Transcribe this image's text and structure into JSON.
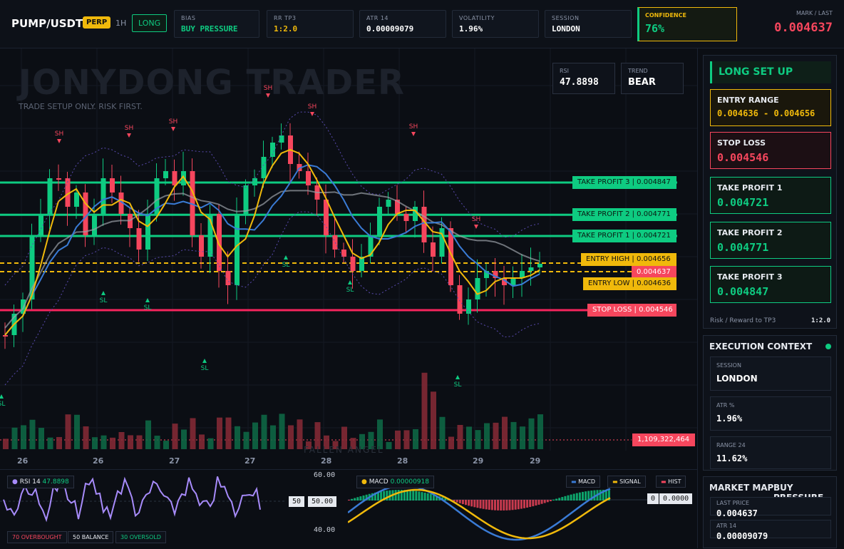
{
  "header": {
    "symbol": "PUMP/USDT",
    "contract": "PERP",
    "timeframe": "1H",
    "side": "LONG",
    "stats": [
      {
        "label": "BIAS",
        "value": "BUY PRESSURE",
        "color": "#0ecb81"
      },
      {
        "label": "RR TP3",
        "value": "1:2.0",
        "color": "#f0b90b"
      },
      {
        "label": "ATR 14",
        "value": "0.00009079",
        "color": "#ffffff"
      },
      {
        "label": "VOLATILITY",
        "value": "1.96%",
        "color": "#ffffff"
      },
      {
        "label": "SESSION",
        "value": "LONDON",
        "color": "#ffffff"
      }
    ],
    "confidence": {
      "label": "CONFIDENCE",
      "value": "76%"
    },
    "mark": {
      "label": "MARK / LAST",
      "value": "0.004637"
    }
  },
  "chart": {
    "watermark": "JONYDONG TRADER",
    "watermark_sub": "TRADE SETUP ONLY. RISK FIRST.",
    "watermark_bottom": "FALLEN ANGEL",
    "rsi_box": {
      "label": "RSI",
      "value": "47.8898"
    },
    "trend_box": {
      "label": "TREND",
      "value": "BEAR"
    },
    "levels": {
      "tp3": {
        "label": "TAKE PROFIT 3",
        "value": "0.004847"
      },
      "tp2": {
        "label": "TAKE PROFIT 2",
        "value": "0.004771"
      },
      "tp1": {
        "label": "TAKE PROFIT 1",
        "value": "0.004721"
      },
      "entry_high": {
        "label": "ENTRY HIGH",
        "value": "0.004656"
      },
      "last": {
        "value": "0.004637"
      },
      "entry_low": {
        "label": "ENTRY LOW",
        "value": "0.004636"
      },
      "stop": {
        "label": "STOP LOSS",
        "value": "0.004546"
      }
    },
    "volume_label": "1,109,322,464",
    "x_labels": [
      "26",
      "26",
      "27",
      "27",
      "28",
      "28",
      "29",
      "29"
    ],
    "swing_high": "SH",
    "swing_low": "SL"
  },
  "rsi_panel": {
    "title": "RSI 14",
    "value": "47.8898",
    "top": "60.00",
    "bottom": "40.00",
    "mid_label": "50",
    "mid_value": "50.00",
    "legend": [
      "70 OVERBOUGHT",
      "50 BALANCE",
      "30 OVERSOLD"
    ]
  },
  "macd_panel": {
    "title": "MACD",
    "value": "0.00000918",
    "legend": [
      "MACD",
      "SIGNAL",
      "HIST"
    ],
    "zero_label": "0",
    "zero_value": "0.0000"
  },
  "sidebar": {
    "setup_title": "LONG SET UP",
    "entry_range": {
      "label": "ENTRY RANGE",
      "value": "0.004636 - 0.004656"
    },
    "stop_loss": {
      "label": "STOP LOSS",
      "value": "0.004546"
    },
    "tp1": {
      "label": "TAKE PROFIT 1",
      "value": "0.004721"
    },
    "tp2": {
      "label": "TAKE PROFIT 2",
      "value": "0.004771"
    },
    "tp3": {
      "label": "TAKE PROFIT 3",
      "value": "0.004847"
    },
    "rr_label": "Risk / Reward to TP3",
    "rr_value": "1:2.0",
    "context_title": "EXECUTION CONTEXT",
    "context": [
      {
        "label": "SESSION",
        "value": "LONDON"
      },
      {
        "label": "ATR %",
        "value": "1.96%"
      },
      {
        "label": "RANGE 24",
        "value": "11.62%"
      }
    ],
    "market_map_title": "MARKET MAP",
    "market_map_bias": "BUY PRESSURE",
    "last_price_label": "LAST PRICE",
    "last_price_value": "0.004637",
    "atr_label": "ATR 14",
    "atr_value": "0.00009079"
  },
  "colors": {
    "green": "#0ecb81",
    "red": "#f6465d",
    "gold": "#f0b90b",
    "blue": "#3a7bd5",
    "gray": "#9aa0a6"
  }
}
